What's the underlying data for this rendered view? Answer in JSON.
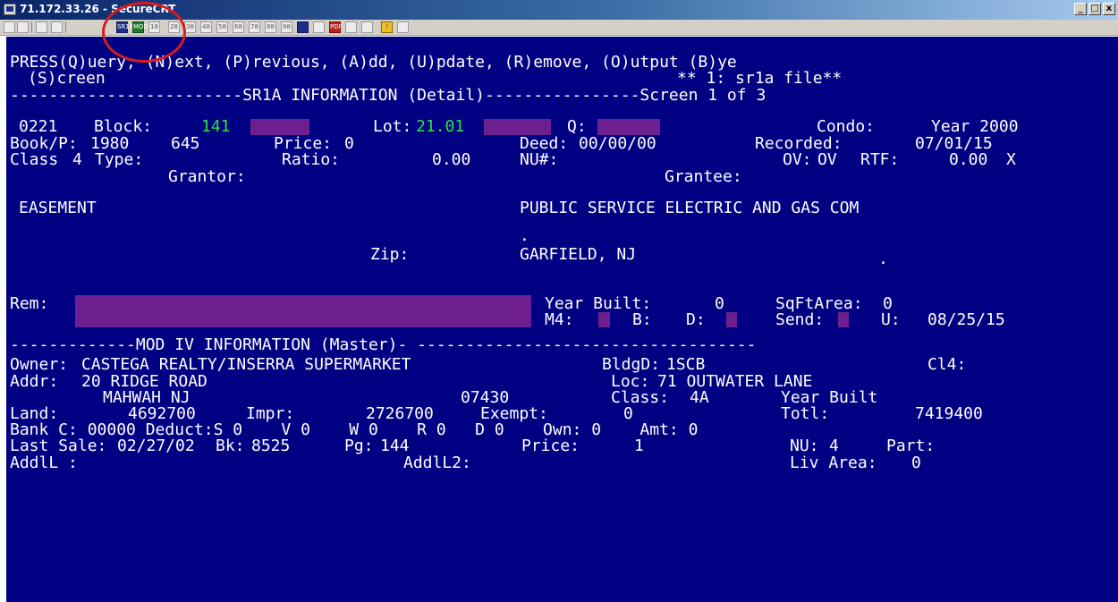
{
  "window": {
    "title": "71.172.33.26 - SecureCRT",
    "controls": [
      "_",
      "□",
      "x"
    ]
  },
  "toolbar": {
    "buttons": [
      {
        "icon": "copy-icon",
        "label": ""
      },
      {
        "icon": "paste-icon",
        "label": ""
      },
      {
        "icon": "print-icon",
        "label": ""
      },
      {
        "icon": "find-icon",
        "label": ""
      },
      {
        "icon": "session-icon",
        "label": "SR1A"
      },
      {
        "icon": "session-icon",
        "label": "MOD"
      },
      {
        "icon": "session-icon",
        "label": "18"
      },
      {
        "icon": "session-icon",
        "label": "28"
      },
      {
        "icon": "session-icon",
        "label": "38"
      },
      {
        "icon": "session-icon",
        "label": "48"
      },
      {
        "icon": "session-icon",
        "label": "58"
      },
      {
        "icon": "session-icon",
        "label": "68"
      },
      {
        "icon": "session-icon",
        "label": "78"
      },
      {
        "icon": "session-icon",
        "label": "88"
      },
      {
        "icon": "session-icon",
        "label": "98"
      },
      {
        "icon": "session-icon",
        "label": ""
      },
      {
        "icon": "map-icon",
        "label": ""
      },
      {
        "icon": "pdf-icon",
        "label": "PDF"
      },
      {
        "icon": "settings-icon",
        "label": ""
      },
      {
        "icon": "settings-icon",
        "label": ""
      },
      {
        "icon": "help-icon",
        "label": "?"
      },
      {
        "icon": "tools-icon",
        "label": ""
      }
    ]
  },
  "terminal": {
    "menu_line": "PRESS(Q)uery, (N)ext, (P)revious, (A)dd, (U)pdate, (R)emove, (O)utput (B)ye",
    "screen_option": "(S)creen",
    "file_indicator": "** 1: sr1a file**",
    "sr1a_header": "------------------------SR1A INFORMATION (Detail)----------------Screen 1 of 3",
    "record_code": "0221",
    "block_label": "Block:",
    "block_value": "141",
    "lot_label": "Lot:",
    "lot_value": "21.01",
    "q_label": "Q:",
    "condo_label": "Condo:",
    "condo_value": "Year 2000",
    "bookp_label": "Book/P:",
    "book_value": "1980",
    "page_value": "645",
    "price_label": "Price:",
    "price_value": "0",
    "deed_label": "Deed:",
    "deed_value": "00/00/00",
    "recorded_label": "Recorded:",
    "recorded_value": "07/01/15",
    "class_label": "Class",
    "class_value": "4",
    "type_label": "Type:",
    "ratio_label": "Ratio:",
    "ratio_value": "0.00",
    "nu_label": "NU#:",
    "ov_label": "OV:",
    "ov_value": "OV",
    "rtf_label": "RTF:",
    "rtf_value": "0.00",
    "rtf_flag": "X",
    "grantor_label": "Grantor:",
    "grantee_label": "Grantee:",
    "grantor_value": "EASEMENT",
    "grantee_value": "PUBLIC SERVICE ELECTRIC AND GAS COM",
    "dot1": ".",
    "zip_label": "Zip:",
    "grantee_city": "GARFIELD, NJ",
    "dot2": ".",
    "rem_label": "Rem:",
    "year_built_label": "Year Built:",
    "year_built_value": "0",
    "sqft_label": "SqFtArea:",
    "sqft_value": "0",
    "m4_label": "M4:",
    "b_label": "B:",
    "d_label": "D:",
    "send_label": "Send:",
    "u_label": "U:",
    "u_value": "08/25/15",
    "modiv_header": "-------------MOD IV INFORMATION (Master)- -----------------------------------",
    "owner_label": "Owner:",
    "owner_value": "CASTEGA REALTY/INSERRA SUPERMARKET",
    "bldgd_label": "BldgD:",
    "bldgd_value": "1SCB",
    "cl4_label": "Cl4:",
    "addr_label": "Addr:",
    "addr_value": "20 RIDGE ROAD",
    "loc_label": "Loc:",
    "loc_value": "71 OUTWATER LANE",
    "addr_city": "MAHWAH NJ",
    "addr_zip": "07430",
    "class2_label": "Class:",
    "class2_value": "4A",
    "year_built2_label": "Year Built",
    "land_label": "Land:",
    "land_value": "4692700",
    "impr_label": "Impr:",
    "impr_value": "2726700",
    "exempt_label": "Exempt:",
    "exempt_value": "0",
    "totl_label": "Totl:",
    "totl_value": "7419400",
    "bank_line": "Bank C: 00000 Deduct:S 0    V 0    W 0    R 0   D 0    Own: 0    Amt: 0",
    "last_sale_label": "Last Sale:",
    "last_sale_value": "02/27/02",
    "bk_label": "Bk:",
    "bk_value": "8525",
    "pg_label": "Pg:",
    "pg_value": "144",
    "price2_label": "Price:",
    "price2_value": "1",
    "nu2_label": "NU:",
    "nu2_value": "4",
    "part_label": "Part:",
    "addl_label": "AddlL :",
    "addl2_label": "AddlL2:",
    "liv_area_label": "Liv Area:",
    "liv_area_value": "0"
  },
  "colors": {
    "terminal_bg": "#000082",
    "terminal_text": "#ffffff",
    "field_green": "#2ee13f",
    "input_band": "#6d1f8f",
    "annotation_circle": "#d51d1d"
  }
}
